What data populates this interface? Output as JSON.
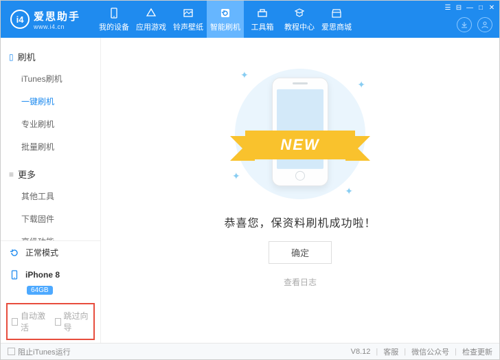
{
  "logo": {
    "badge": "i4",
    "title": "爱思助手",
    "subtitle": "www.i4.cn"
  },
  "nav": {
    "items": [
      {
        "label": "我的设备"
      },
      {
        "label": "应用游戏"
      },
      {
        "label": "铃声壁纸"
      },
      {
        "label": "智能刷机"
      },
      {
        "label": "工具箱"
      },
      {
        "label": "教程中心"
      },
      {
        "label": "爱思商城"
      }
    ]
  },
  "sidebar": {
    "group_flash": "刷机",
    "flash_items": [
      "iTunes刷机",
      "一键刷机",
      "专业刷机",
      "批量刷机"
    ],
    "group_more": "更多",
    "more_items": [
      "其他工具",
      "下载固件",
      "高级功能"
    ],
    "mode": "正常模式",
    "device": "iPhone 8",
    "storage": "64GB",
    "auto_activate": "自动激活",
    "skip_guide": "跳过向导"
  },
  "main": {
    "ribbon": "NEW",
    "message": "恭喜您，保资料刷机成功啦！",
    "confirm": "确定",
    "view_log": "查看日志"
  },
  "footer": {
    "block_itunes": "阻止iTunes运行",
    "version": "V8.12",
    "support": "客服",
    "wechat": "微信公众号",
    "update": "检查更新"
  }
}
